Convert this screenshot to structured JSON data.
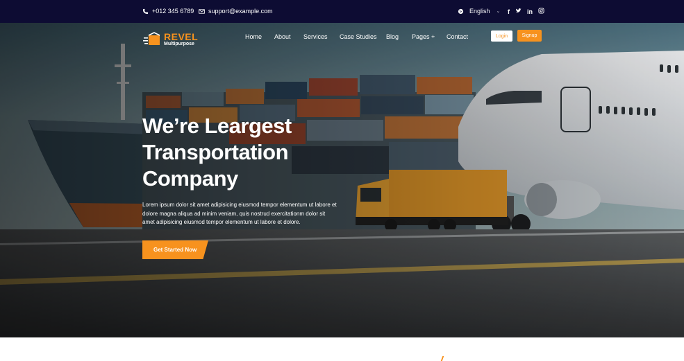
{
  "topbar": {
    "phone": "+012 345 6789",
    "email": "support@example.com",
    "language": "English",
    "social": [
      {
        "icon": "facebook-icon",
        "glyph": "f"
      },
      {
        "icon": "twitter-icon",
        "glyph": "t"
      },
      {
        "icon": "linkedin-icon",
        "glyph": "in"
      },
      {
        "icon": "instagram-icon",
        "glyph": "◎"
      }
    ]
  },
  "brand": {
    "name": "REVEL",
    "tagline": "Multipurpose"
  },
  "nav": {
    "items": [
      "Home",
      "About",
      "Services",
      "Case Studies",
      "Blog",
      "Pages +",
      "Contact"
    ],
    "login_label": "Login",
    "signup_label": "Signup"
  },
  "hero": {
    "headline_lines": [
      "We’re Leargest",
      "Transportation",
      "Company"
    ],
    "lead": "Lorem ipsum dolor sit amet adipisicing eiusmod tempor elementum ut labore et dolore magna aliqua ad minim veniam, quis nostrud exercitationm dolor sit amet adipisicing eiusmod tempor elementum ut labore et dolore.",
    "cta_label": "Get Started Now"
  },
  "colors": {
    "accent": "#f7921e",
    "topbar_bg": "#0d0c33"
  }
}
